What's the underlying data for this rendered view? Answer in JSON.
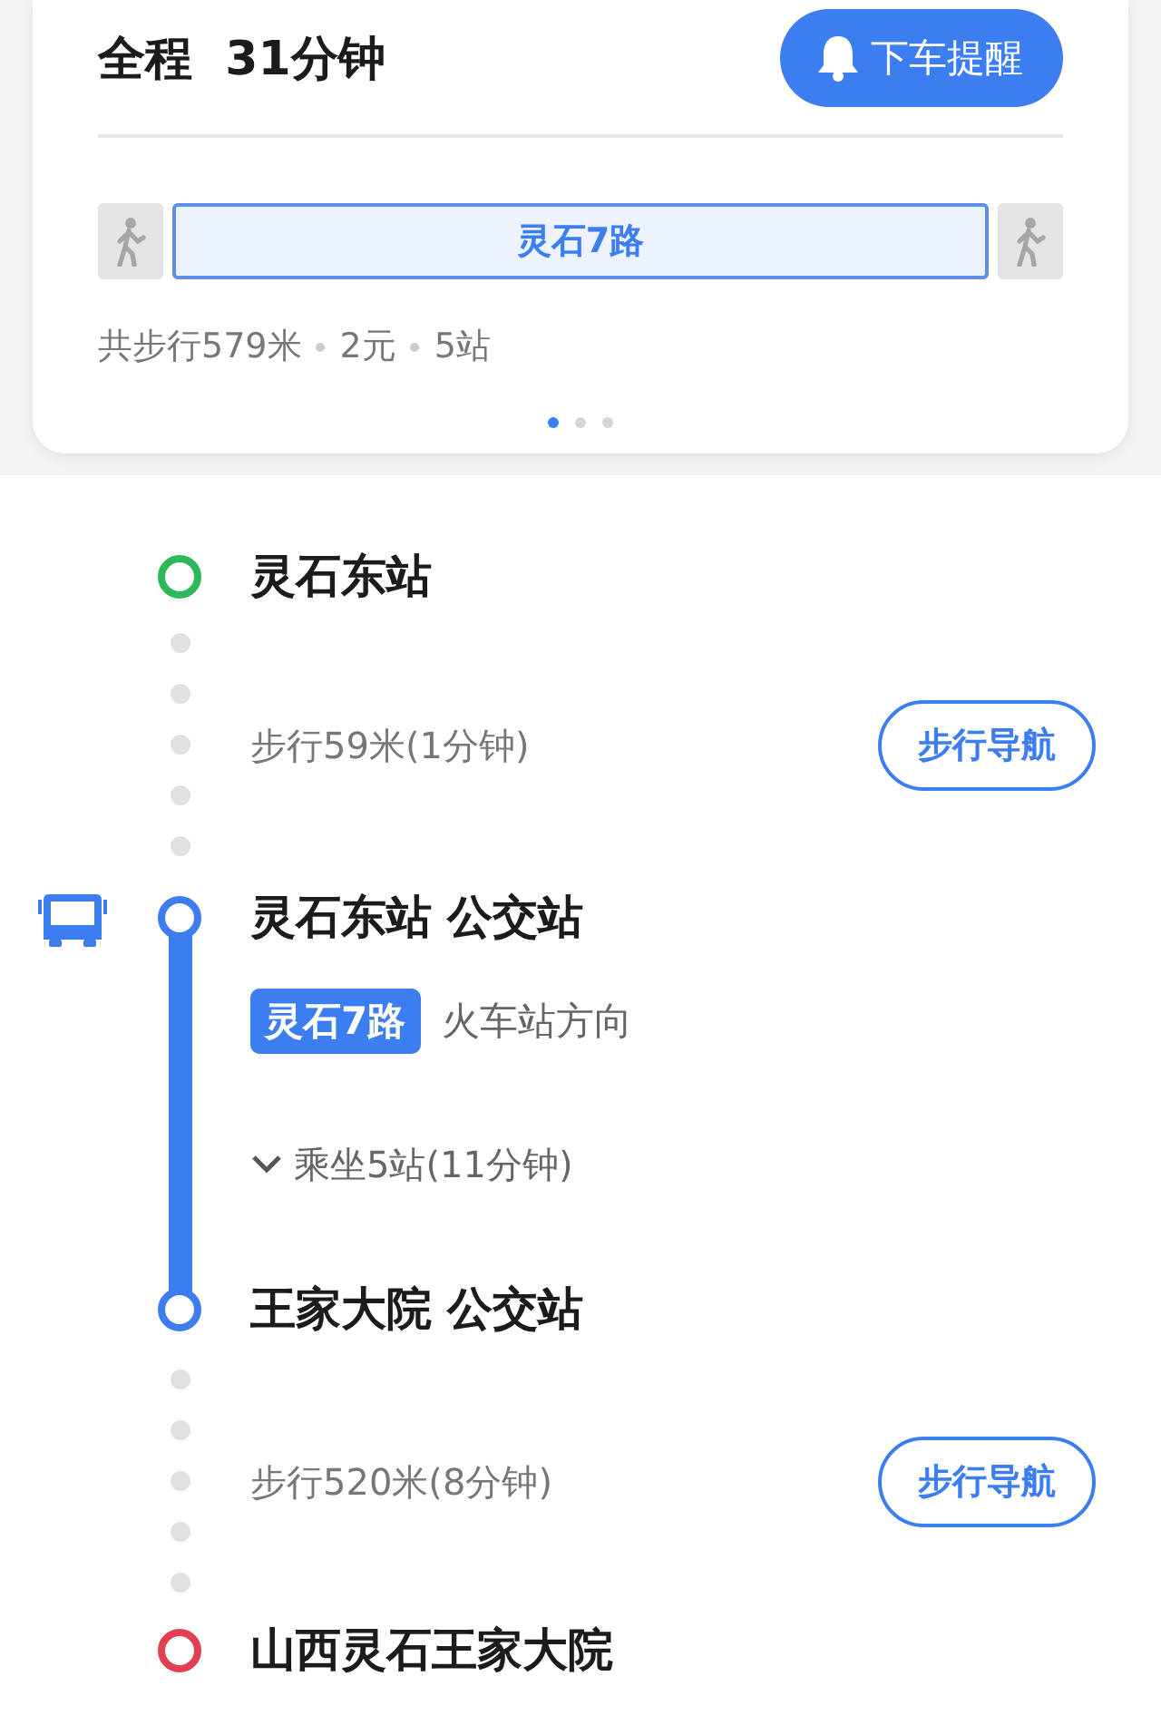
{
  "summary": {
    "title_label": "全程",
    "duration": "31分钟",
    "alert_button": "下车提醒",
    "route_bar": [
      {
        "kind": "walk"
      },
      {
        "kind": "bus",
        "label": "灵石7路"
      },
      {
        "kind": "walk"
      }
    ],
    "stats": [
      "共步行579米",
      "2元",
      "5站"
    ],
    "pages": [
      {
        "selected": true
      },
      {
        "selected": false
      },
      {
        "selected": false
      }
    ]
  },
  "steps": [
    {
      "kind": "endpoint",
      "name": "灵石东站",
      "color": "#2db85a"
    },
    {
      "kind": "walk",
      "text": "步行59米(1分钟)",
      "button": "步行导航"
    },
    {
      "kind": "bus",
      "board": "灵石东站 公交站",
      "line": "灵石7路",
      "direction": "火车站方向",
      "ride": "乘坐5站(11分钟)",
      "expanded": false,
      "alight": "王家大院 公交站"
    },
    {
      "kind": "walk",
      "text": "步行520米(8分钟)",
      "button": "步行导航"
    },
    {
      "kind": "endpoint",
      "name": "山西灵石王家大院",
      "color": "#e0404f"
    }
  ]
}
